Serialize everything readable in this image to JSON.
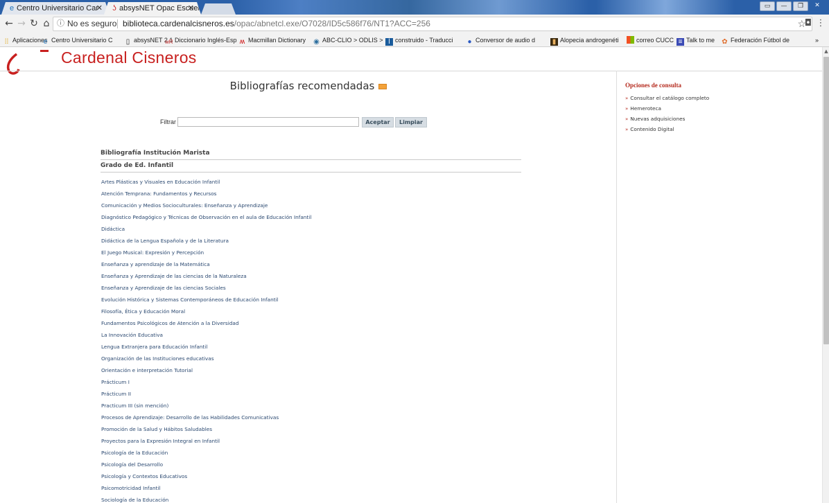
{
  "browser": {
    "tabs": [
      {
        "label": "Centro Universitario Car",
        "active": false,
        "icon": "ie-icon"
      },
      {
        "label": "absysNET Opac Escuela",
        "active": true,
        "icon": "absys-icon"
      }
    ],
    "security_label": "No es seguro",
    "url_domain": "biblioteca.cardenalcisneros.es",
    "url_path": "/opac/abnetcl.exe/O7028/ID5c586f76/NT1?ACC=256",
    "bookmarks": [
      "Aplicaciones",
      "Centro Universitario C",
      "absysNET 2.1",
      "Diccionario Inglés-Esp",
      "Macmillan Dictionary",
      "ABC-CLIO > ODLIS >",
      "construido - Traducci",
      "Conversor de audio d",
      "Alopecia androgenéti",
      "correo CUCC",
      "Talk to me",
      "Federación Fútbol de"
    ],
    "overflow": "»"
  },
  "page": {
    "logo_text": "Cardenal Cisneros",
    "title": "Bibliografías recomendadas",
    "filter": {
      "label": "Filtrar",
      "value": "",
      "accept_label": "Aceptar",
      "clear_label": "Limpiar"
    },
    "section_title": "Bibliografía Institución Marista",
    "section_subtitle": "Grado de Ed. Infantil",
    "courses": [
      "Artes Plásticas y Visuales en Educación Infantil",
      "Atención Temprana: Fundamentos y Recursos",
      "Comunicación y Medios Socioculturales: Enseñanza y Aprendizaje",
      "Diagnóstico Pedagógico y Técnicas de Observación en el aula de Educación Infantil",
      "Didáctica",
      "Didáctica de la Lengua Española y de la Literatura",
      "El Juego Musical: Expresión y Percepción",
      "Enseñanza y aprendizaje de la Matemática",
      "Enseñanza y Aprendizaje de las ciencias de la Naturaleza",
      "Enseñanza y Aprendizaje de las ciencias Sociales",
      "Evolución Histórica y Sistemas Contemporáneos de Educación Infantil",
      "Filosofía, Ética y Educación Moral",
      "Fundamentos Psicológicos de Atención a la Diversidad",
      "La Innovación Educativa",
      "Lengua Extranjera para Educación Infantil",
      "Organización de las Instituciones educativas",
      "Orientación e interpretación Tutorial",
      "Prácticum I",
      "Prácticum II",
      "Practicum III (sin mención)",
      "Procesos de Aprendizaje: Desarrollo de las Habilidades Comunicativas",
      "Promoción de la Salud y Hábitos Saludables",
      "Proyectos para la Expresión Integral en Infantil",
      "Psicología de la Educación",
      "Psicología del Desarrollo",
      "Psicología y Contextos Educativos",
      "Psicomotricidad Infantil",
      "Sociología de la Educación"
    ],
    "sidebar": {
      "title": "Opciones de consulta",
      "links": [
        "Consultar el catálogo completo",
        "Hemeroteca",
        "Nuevas adquisiciones",
        "Contenido Digital"
      ]
    }
  },
  "colors": {
    "link": "#2a4870",
    "accent_red": "#b52b1e",
    "tabbar": "#2b60a8"
  }
}
